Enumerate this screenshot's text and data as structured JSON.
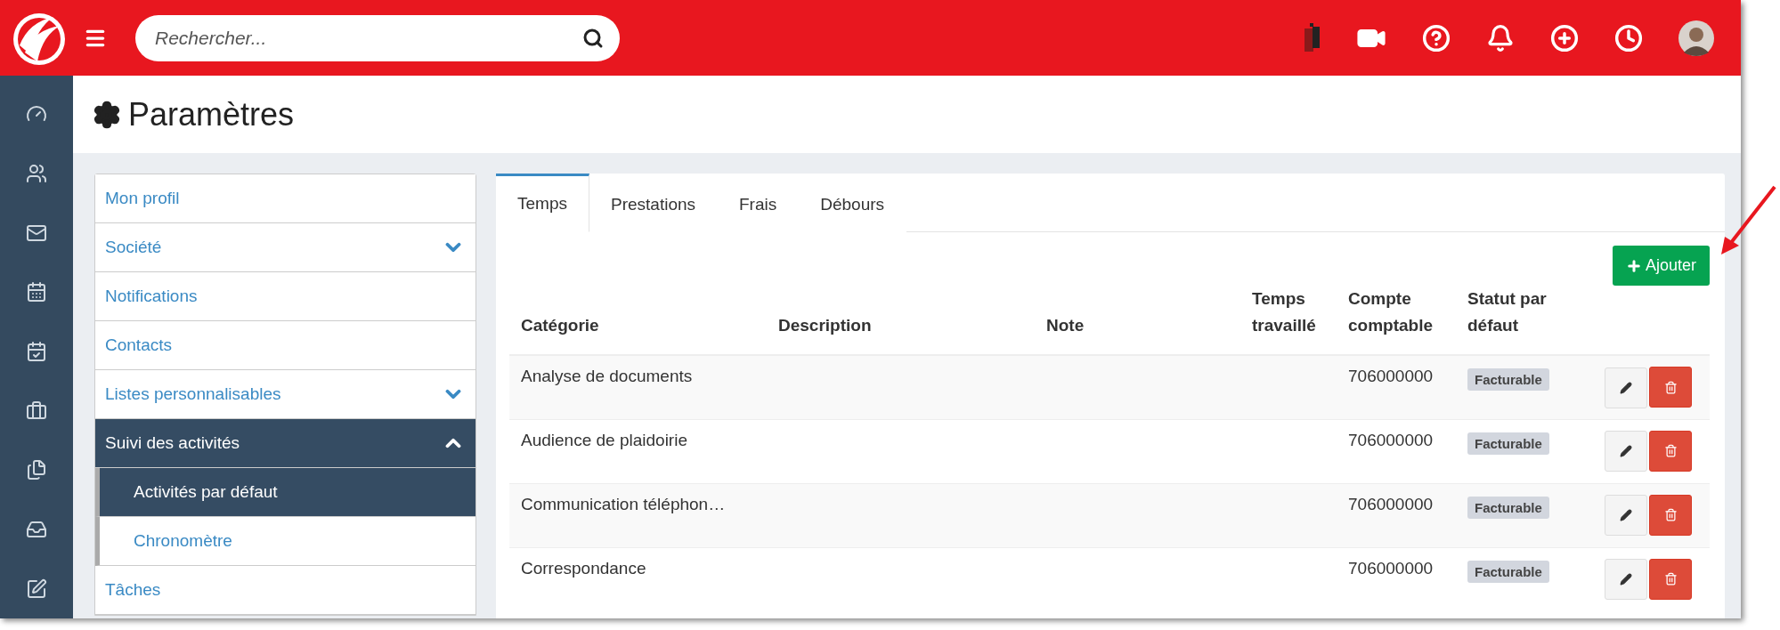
{
  "header": {
    "search": {
      "placeholder": "Rechercher..."
    }
  },
  "page": {
    "title": "Paramètres"
  },
  "settings_menu": [
    {
      "label": "Mon profil",
      "selected": false
    },
    {
      "label": "Société",
      "selected": false,
      "expanded": false
    },
    {
      "label": "Notifications",
      "selected": false
    },
    {
      "label": "Contacts",
      "selected": false
    },
    {
      "label": "Listes personnalisables",
      "selected": false,
      "expanded": false
    },
    {
      "label": "Suivi des activités",
      "selected": true,
      "expanded": true,
      "children": [
        {
          "label": "Activités par défaut",
          "selected": true
        },
        {
          "label": "Chronomètre",
          "selected": false
        }
      ]
    },
    {
      "label": "Tâches",
      "selected": false
    }
  ],
  "tabs": [
    {
      "label": "Temps",
      "selected": true
    },
    {
      "label": "Prestations",
      "selected": false
    },
    {
      "label": "Frais",
      "selected": false
    },
    {
      "label": "Débours",
      "selected": false
    }
  ],
  "add_button": "Ajouter",
  "table": {
    "columns": [
      "Catégorie",
      "Description",
      "Note",
      "Temps travaillé",
      "Compte comptable",
      "Statut par défaut"
    ],
    "rows": [
      {
        "category": "Analyse de documents",
        "account": "706000000",
        "status": "Facturable"
      },
      {
        "category": "Audience de plaidoirie",
        "account": "706000000",
        "status": "Facturable"
      },
      {
        "category": "Communication téléphon…",
        "account": "706000000",
        "status": "Facturable"
      },
      {
        "category": "Correspondance",
        "account": "706000000",
        "status": "Facturable"
      }
    ]
  }
}
